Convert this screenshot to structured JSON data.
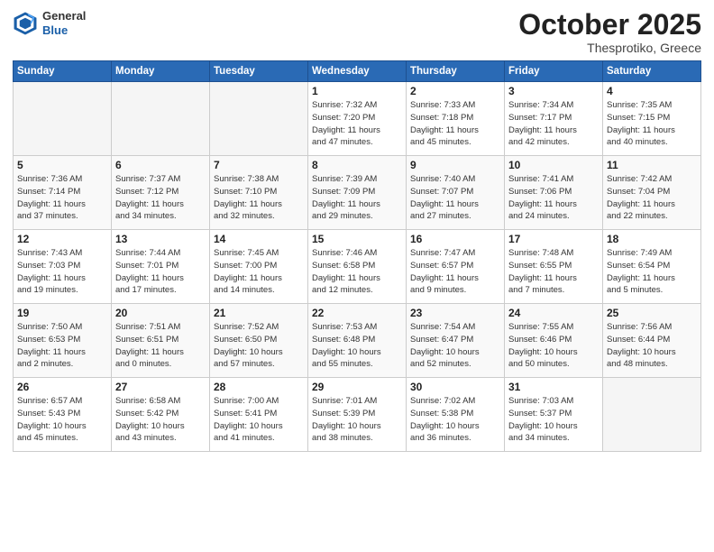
{
  "header": {
    "logo_general": "General",
    "logo_blue": "Blue",
    "month_title": "October 2025",
    "location": "Thesprotiko, Greece"
  },
  "weekdays": [
    "Sunday",
    "Monday",
    "Tuesday",
    "Wednesday",
    "Thursday",
    "Friday",
    "Saturday"
  ],
  "weeks": [
    [
      {
        "day": "",
        "info": ""
      },
      {
        "day": "",
        "info": ""
      },
      {
        "day": "",
        "info": ""
      },
      {
        "day": "1",
        "info": "Sunrise: 7:32 AM\nSunset: 7:20 PM\nDaylight: 11 hours\nand 47 minutes."
      },
      {
        "day": "2",
        "info": "Sunrise: 7:33 AM\nSunset: 7:18 PM\nDaylight: 11 hours\nand 45 minutes."
      },
      {
        "day": "3",
        "info": "Sunrise: 7:34 AM\nSunset: 7:17 PM\nDaylight: 11 hours\nand 42 minutes."
      },
      {
        "day": "4",
        "info": "Sunrise: 7:35 AM\nSunset: 7:15 PM\nDaylight: 11 hours\nand 40 minutes."
      }
    ],
    [
      {
        "day": "5",
        "info": "Sunrise: 7:36 AM\nSunset: 7:14 PM\nDaylight: 11 hours\nand 37 minutes."
      },
      {
        "day": "6",
        "info": "Sunrise: 7:37 AM\nSunset: 7:12 PM\nDaylight: 11 hours\nand 34 minutes."
      },
      {
        "day": "7",
        "info": "Sunrise: 7:38 AM\nSunset: 7:10 PM\nDaylight: 11 hours\nand 32 minutes."
      },
      {
        "day": "8",
        "info": "Sunrise: 7:39 AM\nSunset: 7:09 PM\nDaylight: 11 hours\nand 29 minutes."
      },
      {
        "day": "9",
        "info": "Sunrise: 7:40 AM\nSunset: 7:07 PM\nDaylight: 11 hours\nand 27 minutes."
      },
      {
        "day": "10",
        "info": "Sunrise: 7:41 AM\nSunset: 7:06 PM\nDaylight: 11 hours\nand 24 minutes."
      },
      {
        "day": "11",
        "info": "Sunrise: 7:42 AM\nSunset: 7:04 PM\nDaylight: 11 hours\nand 22 minutes."
      }
    ],
    [
      {
        "day": "12",
        "info": "Sunrise: 7:43 AM\nSunset: 7:03 PM\nDaylight: 11 hours\nand 19 minutes."
      },
      {
        "day": "13",
        "info": "Sunrise: 7:44 AM\nSunset: 7:01 PM\nDaylight: 11 hours\nand 17 minutes."
      },
      {
        "day": "14",
        "info": "Sunrise: 7:45 AM\nSunset: 7:00 PM\nDaylight: 11 hours\nand 14 minutes."
      },
      {
        "day": "15",
        "info": "Sunrise: 7:46 AM\nSunset: 6:58 PM\nDaylight: 11 hours\nand 12 minutes."
      },
      {
        "day": "16",
        "info": "Sunrise: 7:47 AM\nSunset: 6:57 PM\nDaylight: 11 hours\nand 9 minutes."
      },
      {
        "day": "17",
        "info": "Sunrise: 7:48 AM\nSunset: 6:55 PM\nDaylight: 11 hours\nand 7 minutes."
      },
      {
        "day": "18",
        "info": "Sunrise: 7:49 AM\nSunset: 6:54 PM\nDaylight: 11 hours\nand 5 minutes."
      }
    ],
    [
      {
        "day": "19",
        "info": "Sunrise: 7:50 AM\nSunset: 6:53 PM\nDaylight: 11 hours\nand 2 minutes."
      },
      {
        "day": "20",
        "info": "Sunrise: 7:51 AM\nSunset: 6:51 PM\nDaylight: 11 hours\nand 0 minutes."
      },
      {
        "day": "21",
        "info": "Sunrise: 7:52 AM\nSunset: 6:50 PM\nDaylight: 10 hours\nand 57 minutes."
      },
      {
        "day": "22",
        "info": "Sunrise: 7:53 AM\nSunset: 6:48 PM\nDaylight: 10 hours\nand 55 minutes."
      },
      {
        "day": "23",
        "info": "Sunrise: 7:54 AM\nSunset: 6:47 PM\nDaylight: 10 hours\nand 52 minutes."
      },
      {
        "day": "24",
        "info": "Sunrise: 7:55 AM\nSunset: 6:46 PM\nDaylight: 10 hours\nand 50 minutes."
      },
      {
        "day": "25",
        "info": "Sunrise: 7:56 AM\nSunset: 6:44 PM\nDaylight: 10 hours\nand 48 minutes."
      }
    ],
    [
      {
        "day": "26",
        "info": "Sunrise: 6:57 AM\nSunset: 5:43 PM\nDaylight: 10 hours\nand 45 minutes."
      },
      {
        "day": "27",
        "info": "Sunrise: 6:58 AM\nSunset: 5:42 PM\nDaylight: 10 hours\nand 43 minutes."
      },
      {
        "day": "28",
        "info": "Sunrise: 7:00 AM\nSunset: 5:41 PM\nDaylight: 10 hours\nand 41 minutes."
      },
      {
        "day": "29",
        "info": "Sunrise: 7:01 AM\nSunset: 5:39 PM\nDaylight: 10 hours\nand 38 minutes."
      },
      {
        "day": "30",
        "info": "Sunrise: 7:02 AM\nSunset: 5:38 PM\nDaylight: 10 hours\nand 36 minutes."
      },
      {
        "day": "31",
        "info": "Sunrise: 7:03 AM\nSunset: 5:37 PM\nDaylight: 10 hours\nand 34 minutes."
      },
      {
        "day": "",
        "info": ""
      }
    ]
  ]
}
